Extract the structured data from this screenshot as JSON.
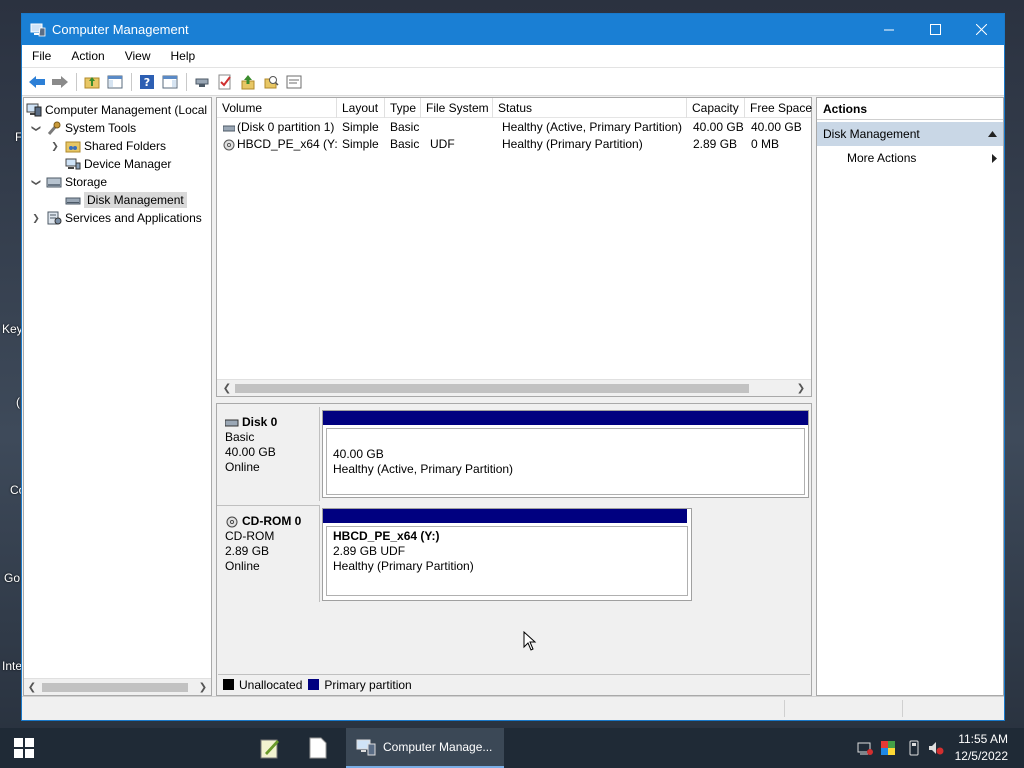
{
  "desktop": {
    "edge_labels": [
      "F",
      "Key",
      "(",
      "Co",
      "Go",
      "Inte"
    ]
  },
  "window": {
    "title": "Computer Management",
    "menu": [
      "File",
      "Action",
      "View",
      "Help"
    ]
  },
  "tree": {
    "items": [
      {
        "label": "Computer Management (Local",
        "level": 0,
        "expander": "",
        "icon": "computer-management-icon"
      },
      {
        "label": "System Tools",
        "level": 1,
        "expander": "expanded",
        "icon": "tools-icon"
      },
      {
        "label": "Shared Folders",
        "level": 2,
        "expander": "collapsed",
        "icon": "shared-folder-icon"
      },
      {
        "label": "Device Manager",
        "level": 2,
        "expander": "",
        "icon": "device-manager-icon"
      },
      {
        "label": "Storage",
        "level": 1,
        "expander": "expanded",
        "icon": "storage-icon"
      },
      {
        "label": "Disk Management",
        "level": 2,
        "expander": "",
        "icon": "disk-icon",
        "selected": true
      },
      {
        "label": "Services and Applications",
        "level": 1,
        "expander": "collapsed",
        "icon": "services-icon"
      }
    ]
  },
  "volume_list": {
    "columns": [
      "Volume",
      "Layout",
      "Type",
      "File System",
      "Status",
      "Capacity",
      "Free Space"
    ],
    "rows": [
      {
        "volume": "(Disk 0 partition 1)",
        "layout": "Simple",
        "type": "Basic",
        "fs": "",
        "status": "Healthy (Active, Primary Partition)",
        "capacity": "40.00 GB",
        "free": "40.00 GB",
        "icon": "drive-icon"
      },
      {
        "volume": "HBCD_PE_x64 (Y:)",
        "layout": "Simple",
        "type": "Basic",
        "fs": "UDF",
        "status": "Healthy (Primary Partition)",
        "capacity": "2.89 GB",
        "free": "0 MB",
        "icon": "cdrom-icon"
      }
    ]
  },
  "disks": [
    {
      "name": "Disk 0",
      "kind": "Basic",
      "size": "40.00 GB",
      "state": "Online",
      "partition": {
        "title": "",
        "line1": "40.00 GB",
        "line2": "Healthy (Active, Primary Partition)"
      }
    },
    {
      "name": "CD-ROM 0",
      "kind": "CD-ROM",
      "size": "2.89 GB",
      "state": "Online",
      "partition": {
        "title": "HBCD_PE_x64  (Y:)",
        "line1": "2.89 GB UDF",
        "line2": "Healthy (Primary Partition)"
      }
    }
  ],
  "legend": [
    {
      "label": "Unallocated",
      "color": "#000000"
    },
    {
      "label": "Primary partition",
      "color": "#000080"
    }
  ],
  "actions": {
    "title": "Actions",
    "section": "Disk Management",
    "items": [
      "More Actions"
    ]
  },
  "taskbar": {
    "active_label": "Computer Manage...",
    "time": "11:55 AM",
    "date": "12/5/2022"
  },
  "colors": {
    "titlebar": "#1a7fd4",
    "partition_bar": "#000080",
    "actions_section": "#c9d7e6"
  }
}
